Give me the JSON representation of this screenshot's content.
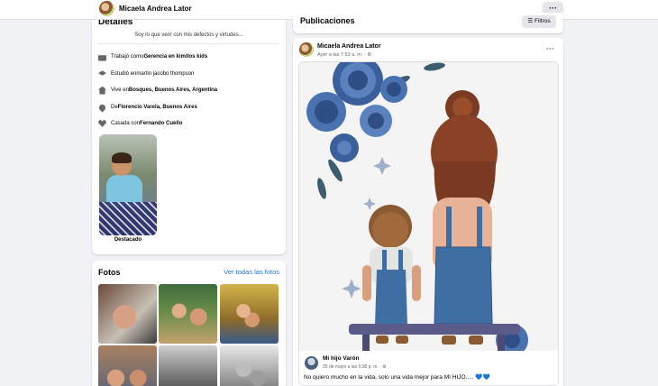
{
  "topbar": {
    "profile_name": "Micaela Andrea Lator",
    "more_label": "···"
  },
  "details": {
    "title": "Detalles",
    "bio": "Soy lo que ven! con mis defectos y virtudes...",
    "items": [
      {
        "icon": "briefcase-icon",
        "text_pre": "Trabajó como ",
        "text_bold": "Gerencia en kimitos kids"
      },
      {
        "icon": "graduation-cap-icon",
        "text_pre": "Estudió en ",
        "text_bold": "martin jacobo thompson"
      },
      {
        "icon": "house-icon",
        "text_pre": "Vive en ",
        "text_bold": "Bosques, Buenos Aires, Argentina"
      },
      {
        "icon": "location-pin-icon",
        "text_pre": "De ",
        "text_bold": "Florencio Varela, Buenos Aires"
      },
      {
        "icon": "heart-icon",
        "text_pre": "Casada con ",
        "text_bold": "Fernando Cuello"
      }
    ],
    "featured_label": "Destacado"
  },
  "photos": {
    "title": "Fotos",
    "see_all": "Ver todas las fotos"
  },
  "publications": {
    "title": "Publicaciones",
    "filter_label": "Filtros"
  },
  "post": {
    "author": "Micaela Andrea Lator",
    "time": "Ayer a las 7:53 a. m. · ⚙",
    "more": "···",
    "shared": {
      "author": "Mi hijo Varón",
      "time": "25 de mayo a las 5:38 p. m. · ⚙",
      "text": "No quiero mucho en la vida, solo una vida mejor para MI HIJO.....",
      "hearts": "💙💙"
    }
  },
  "colors": {
    "link": "#216fdb",
    "background": "#f0f2f5",
    "denim": "#3f6ea3",
    "rose": "#5b7fb8"
  }
}
